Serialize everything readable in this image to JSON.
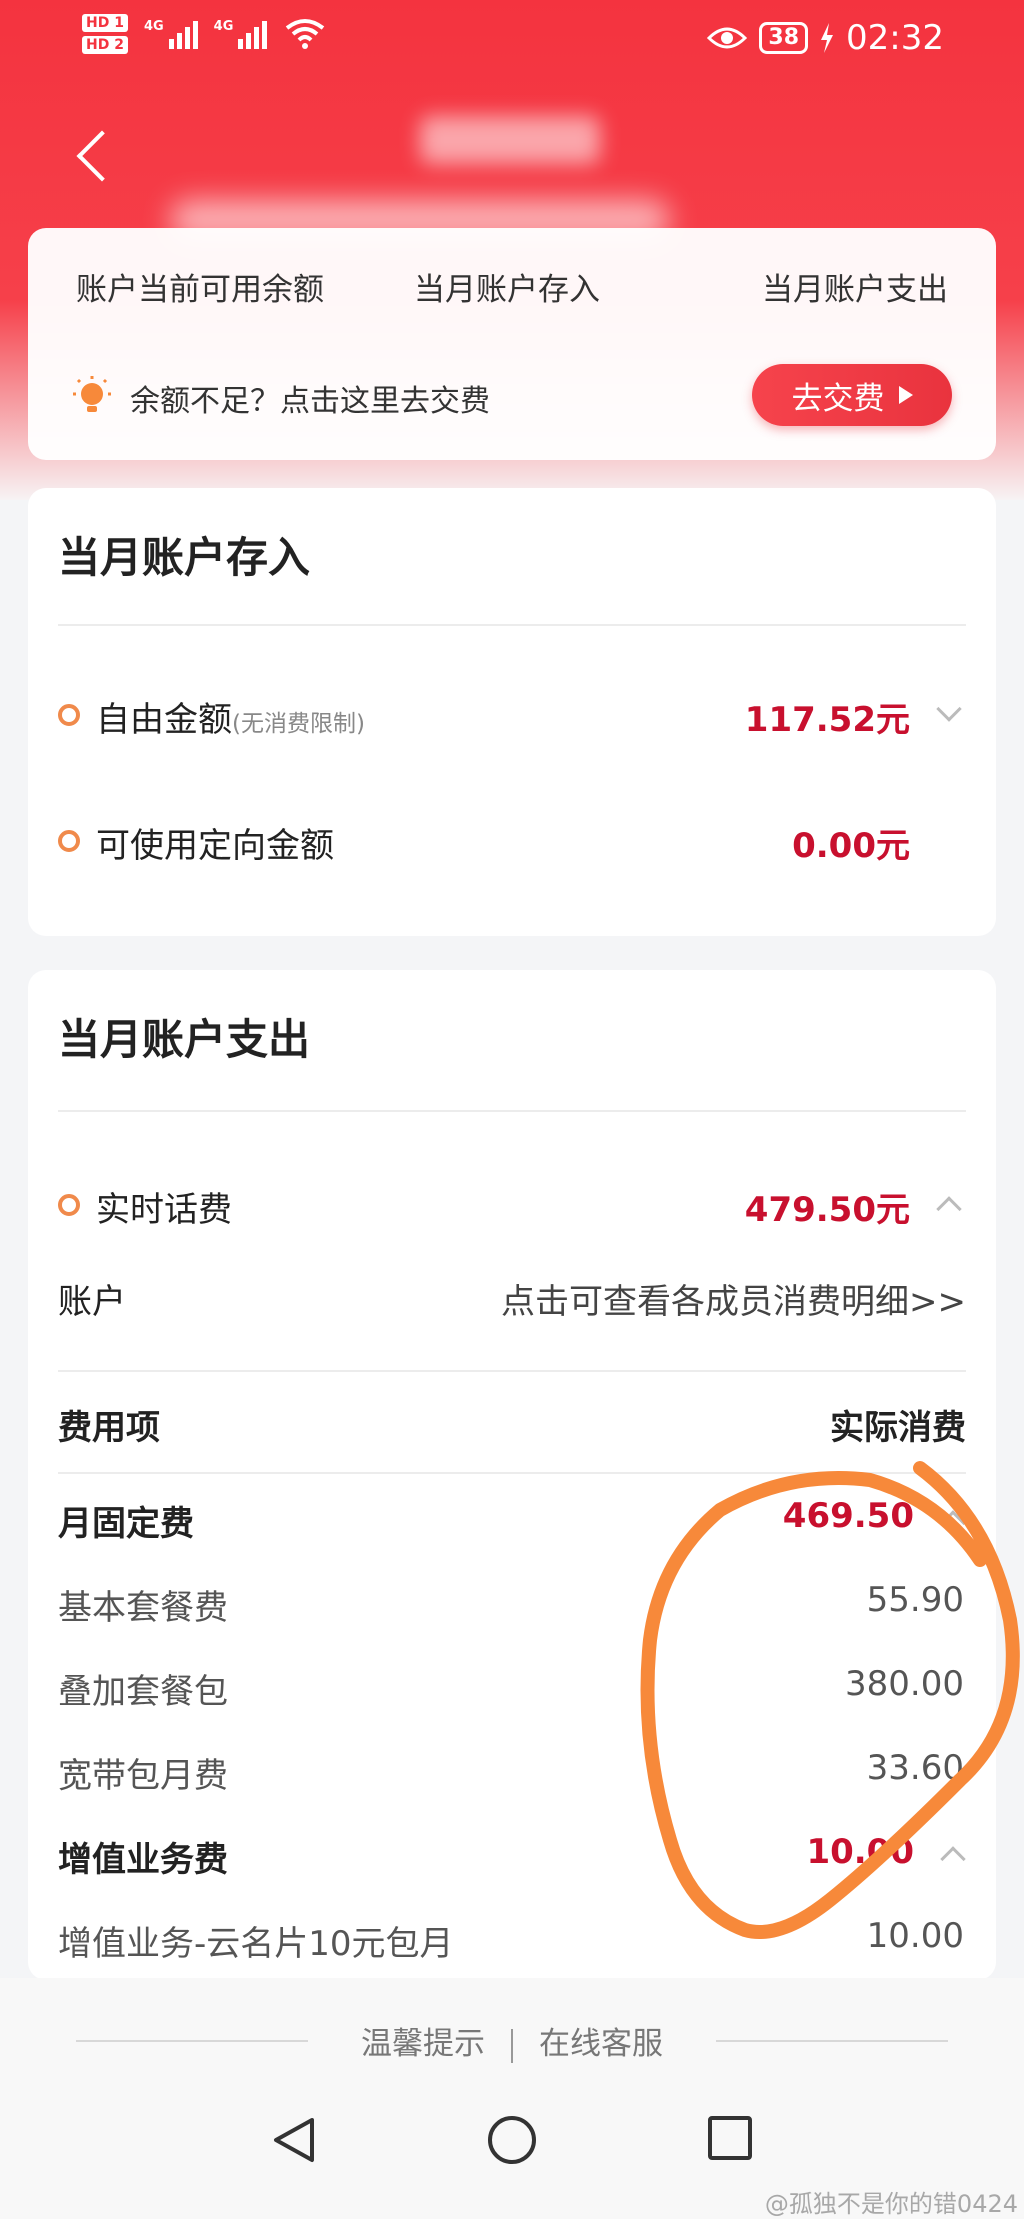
{
  "status_bar": {
    "hd1": "HD 1",
    "hd2": "HD 2",
    "net1": "4G",
    "net2": "4G",
    "battery": "38",
    "time": "02:32"
  },
  "summary": {
    "available_balance_label": "账户当前可用余额",
    "month_deposit_label": "当月账户存入",
    "month_expense_label": "当月账户支出",
    "tip_text": "余额不足？点击这里去交费",
    "pay_button_label": "去交费"
  },
  "deposit_card": {
    "title": "当月账户存入",
    "free_amount_label": "自由金额",
    "free_amount_note": "(无消费限制)",
    "free_amount_value": "117.52元",
    "directed_amount_label": "可使用定向金额",
    "directed_amount_value": "0.00元"
  },
  "expense_card": {
    "title": "当月账户支出",
    "realtime_fee_label": "实时话费",
    "realtime_fee_value": "479.50元",
    "account_label": "账户",
    "account_link": "点击可查看各成员消费明细>>",
    "fee_item_header": "费用项",
    "actual_consumption_header": "实际消费",
    "rows": [
      {
        "label": "月固定费",
        "value": "469.50",
        "group": true
      },
      {
        "label": "基本套餐费",
        "value": "55.90",
        "group": false
      },
      {
        "label": "叠加套餐包",
        "value": "380.00",
        "group": false
      },
      {
        "label": "宽带包月费",
        "value": "33.60",
        "group": false
      },
      {
        "label": "增值业务费",
        "value": "10.00",
        "group": true
      },
      {
        "label": "增值业务-云名片10元包月",
        "value": "10.00",
        "group": false
      }
    ]
  },
  "footer": {
    "tips_link": "温馨提示",
    "service_link": "在线客服"
  },
  "watermark": "@孤独不是你的错0424",
  "colors": {
    "header_red": "#f4333f",
    "amount_red": "#c8102e",
    "dot_orange": "#f08a4b",
    "annotation_orange": "#f7893a"
  }
}
